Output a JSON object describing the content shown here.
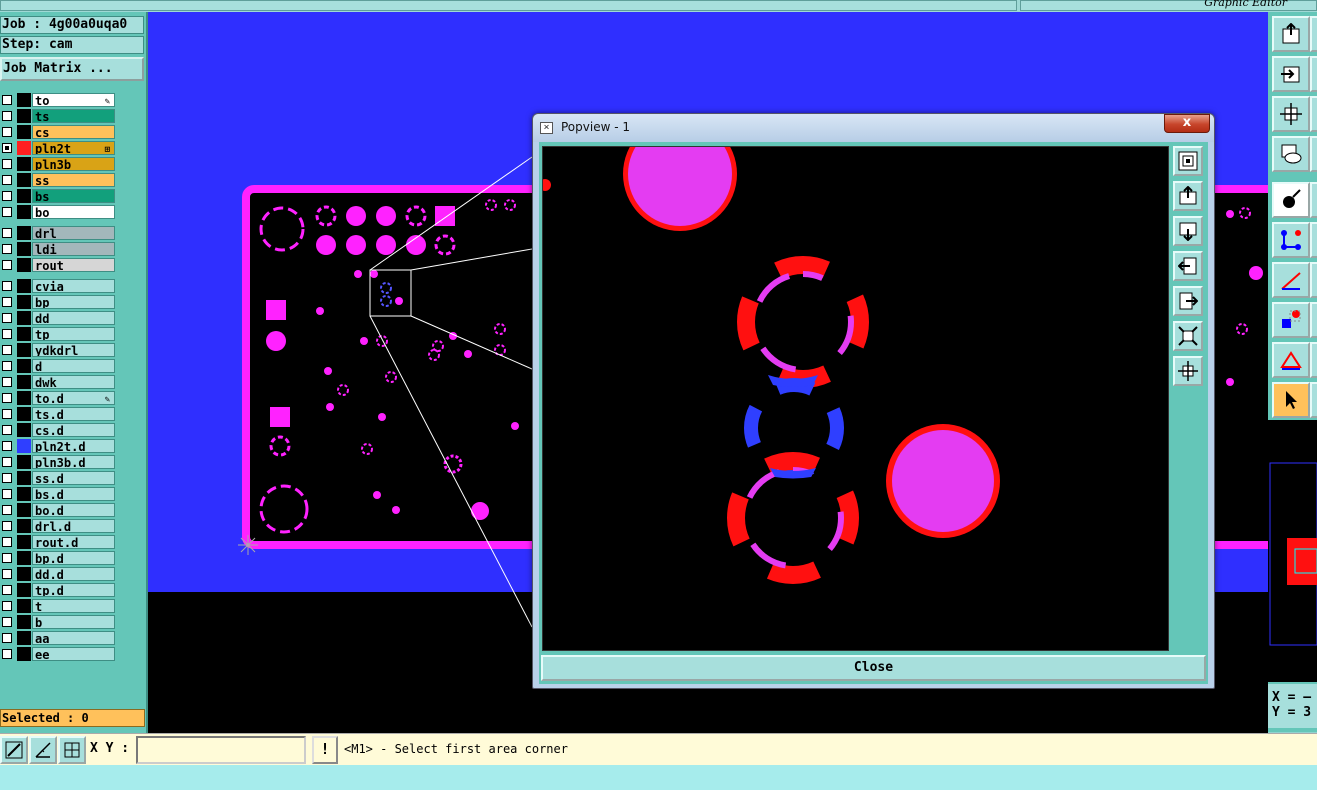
{
  "app": {
    "title": "Graphic Editor"
  },
  "left_panel": {
    "job": "Job : 4g00a0uqa0",
    "step": "Step: cam",
    "job_matrix_label": "Job Matrix ...",
    "selected": "Selected : 0",
    "layers": [
      {
        "name": "to",
        "bg": "#ffffff",
        "color": "#000000",
        "checked": false,
        "mark": "✎"
      },
      {
        "name": "ts",
        "bg": "#12a07c",
        "color": "#000000",
        "checked": false,
        "mark": ""
      },
      {
        "name": "cs",
        "bg": "#ffc15b",
        "color": "#000000",
        "checked": false,
        "mark": ""
      },
      {
        "name": "pln2t",
        "bg": "#d9a316",
        "color": "#ff2020",
        "checked": true,
        "mark": "⊞"
      },
      {
        "name": "pln3b",
        "bg": "#d9a316",
        "color": "#000000",
        "checked": false,
        "mark": ""
      },
      {
        "name": "ss",
        "bg": "#ffc15b",
        "color": "#000000",
        "checked": false,
        "mark": ""
      },
      {
        "name": "bs",
        "bg": "#12a07c",
        "color": "#000000",
        "checked": false,
        "mark": ""
      },
      {
        "name": "bo",
        "bg": "#ffffff",
        "color": "#000000",
        "checked": false,
        "mark": ""
      },
      {
        "name": "drl",
        "bg": "#a3b7bb",
        "color": "#000000",
        "checked": false,
        "mark": ""
      },
      {
        "name": "ldi",
        "bg": "#a3b7bb",
        "color": "#000000",
        "checked": false,
        "mark": ""
      },
      {
        "name": "rout",
        "bg": "#d6d6d6",
        "color": "#000000",
        "checked": false,
        "mark": ""
      },
      {
        "name": "cvia",
        "bg": "#a7dfdc",
        "color": "#000000",
        "checked": false,
        "mark": ""
      },
      {
        "name": "bp",
        "bg": "#a7dfdc",
        "color": "#000000",
        "checked": false,
        "mark": ""
      },
      {
        "name": "dd",
        "bg": "#a7dfdc",
        "color": "#000000",
        "checked": false,
        "mark": ""
      },
      {
        "name": "tp",
        "bg": "#a7dfdc",
        "color": "#000000",
        "checked": false,
        "mark": ""
      },
      {
        "name": "ydkdrl",
        "bg": "#a7dfdc",
        "color": "#000000",
        "checked": false,
        "mark": ""
      },
      {
        "name": "d",
        "bg": "#a7dfdc",
        "color": "#000000",
        "checked": false,
        "mark": ""
      },
      {
        "name": "dwk",
        "bg": "#a7dfdc",
        "color": "#000000",
        "checked": false,
        "mark": ""
      },
      {
        "name": "to.d",
        "bg": "#a7dfdc",
        "color": "#000000",
        "checked": false,
        "mark": "✎"
      },
      {
        "name": "ts.d",
        "bg": "#a7dfdc",
        "color": "#000000",
        "checked": false,
        "mark": ""
      },
      {
        "name": "cs.d",
        "bg": "#a7dfdc",
        "color": "#000000",
        "checked": false,
        "mark": ""
      },
      {
        "name": "pln2t.d",
        "bg": "#a7dfdc",
        "color": "#2f3fff",
        "checked": false,
        "mark": ""
      },
      {
        "name": "pln3b.d",
        "bg": "#a7dfdc",
        "color": "#000000",
        "checked": false,
        "mark": ""
      },
      {
        "name": "ss.d",
        "bg": "#a7dfdc",
        "color": "#000000",
        "checked": false,
        "mark": ""
      },
      {
        "name": "bs.d",
        "bg": "#a7dfdc",
        "color": "#000000",
        "checked": false,
        "mark": ""
      },
      {
        "name": "bo.d",
        "bg": "#a7dfdc",
        "color": "#000000",
        "checked": false,
        "mark": ""
      },
      {
        "name": "drl.d",
        "bg": "#a7dfdc",
        "color": "#000000",
        "checked": false,
        "mark": ""
      },
      {
        "name": "rout.d",
        "bg": "#a7dfdc",
        "color": "#000000",
        "checked": false,
        "mark": ""
      },
      {
        "name": "bp.d",
        "bg": "#a7dfdc",
        "color": "#000000",
        "checked": false,
        "mark": ""
      },
      {
        "name": "dd.d",
        "bg": "#a7dfdc",
        "color": "#000000",
        "checked": false,
        "mark": ""
      },
      {
        "name": "tp.d",
        "bg": "#a7dfdc",
        "color": "#000000",
        "checked": false,
        "mark": ""
      },
      {
        "name": "t",
        "bg": "#a7dfdc",
        "color": "#000000",
        "checked": false,
        "mark": ""
      },
      {
        "name": "b",
        "bg": "#a7dfdc",
        "color": "#000000",
        "checked": false,
        "mark": ""
      },
      {
        "name": "aa",
        "bg": "#a7dfdc",
        "color": "#000000",
        "checked": false,
        "mark": ""
      },
      {
        "name": "ee",
        "bg": "#a7dfdc",
        "color": "#000000",
        "checked": false,
        "mark": ""
      }
    ]
  },
  "popview": {
    "title": "Popview - 1",
    "close_x": "x",
    "close_label": "Close"
  },
  "status": {
    "xy_label": "X Y :",
    "xy_value": "",
    "warn_label": "!",
    "message": "<M1> - Select first area corner"
  },
  "readout": {
    "x": "X = –",
    "y": "Y = 3"
  },
  "colors": {
    "board_blue": "#2f2fff",
    "magenta": "#ff22ff",
    "red": "#ff1010",
    "panel_teal": "#64c6b8",
    "light_teal": "#a7dfdc",
    "selected_orange": "#ffc15b"
  },
  "icons": {
    "right_toolbar": [
      "export-icon",
      "import-icon",
      "move-icon",
      "palette-icon",
      "feature-icon",
      "net-icon",
      "measure-icon",
      "snap-icon",
      "drc-icon",
      "pointer-icon"
    ],
    "popview_toolbar": [
      "zoom-icon",
      "pan-up-icon",
      "pan-down-icon",
      "pan-left-icon",
      "pan-right-icon",
      "fit-icon",
      "center-icon"
    ],
    "bottom": [
      "zoom-area-icon",
      "measure-icon",
      "grid-icon"
    ]
  }
}
